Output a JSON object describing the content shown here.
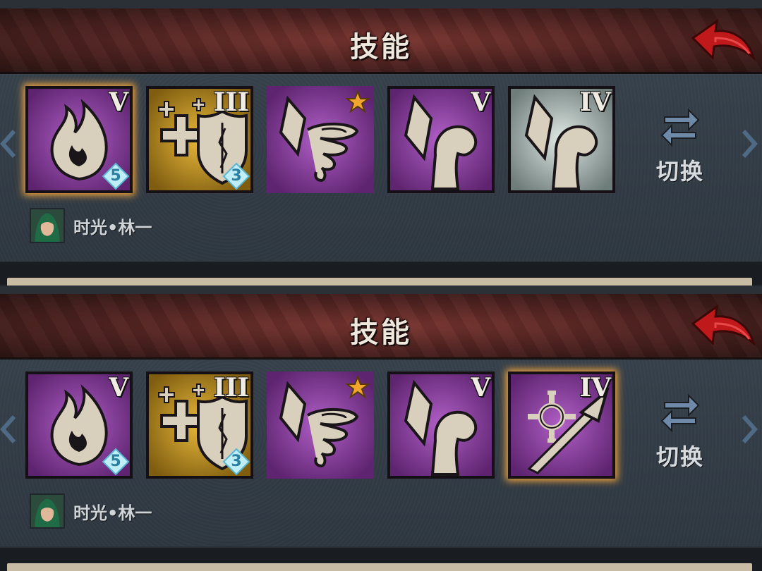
{
  "panels": [
    {
      "title": "技能",
      "slots": [
        {
          "icon": "flame-icon",
          "bg": "purple",
          "rank": "V",
          "level": "5",
          "state": "selected"
        },
        {
          "icon": "heal-shield-icon",
          "bg": "gold",
          "rank": "III",
          "level": "3",
          "state": "normal"
        },
        {
          "icon": "crystal-tornado-icon",
          "bg": "purple",
          "star": true,
          "state": "orange"
        },
        {
          "icon": "crystal-arm-icon",
          "bg": "purple",
          "rank": "V",
          "state": "normal"
        },
        {
          "icon": "crystal-arm-icon",
          "bg": "silver",
          "rank": "IV",
          "state": "normal"
        }
      ],
      "switch_label": "切换",
      "hero_name": "时光•林一"
    },
    {
      "title": "技能",
      "slots": [
        {
          "icon": "flame-icon",
          "bg": "purple",
          "rank": "V",
          "level": "5",
          "state": "normal"
        },
        {
          "icon": "heal-shield-icon",
          "bg": "gold",
          "rank": "III",
          "level": "3",
          "state": "normal"
        },
        {
          "icon": "crystal-tornado-icon",
          "bg": "purple",
          "star": true,
          "state": "orange"
        },
        {
          "icon": "crystal-arm-icon",
          "bg": "purple",
          "rank": "V",
          "state": "normal"
        },
        {
          "icon": "target-spear-icon",
          "bg": "purple",
          "rank": "IV",
          "state": "selected"
        }
      ],
      "switch_label": "切换",
      "hero_name": "时光•林一"
    }
  ],
  "colors": {
    "header": "#5a2623",
    "purple_bg": "#8a3fa0",
    "gold_bg": "#c7961f",
    "silver_bg": "#b8c6c4",
    "selected_glow": "#f4a53c",
    "orange_border": "#e07a3a"
  }
}
